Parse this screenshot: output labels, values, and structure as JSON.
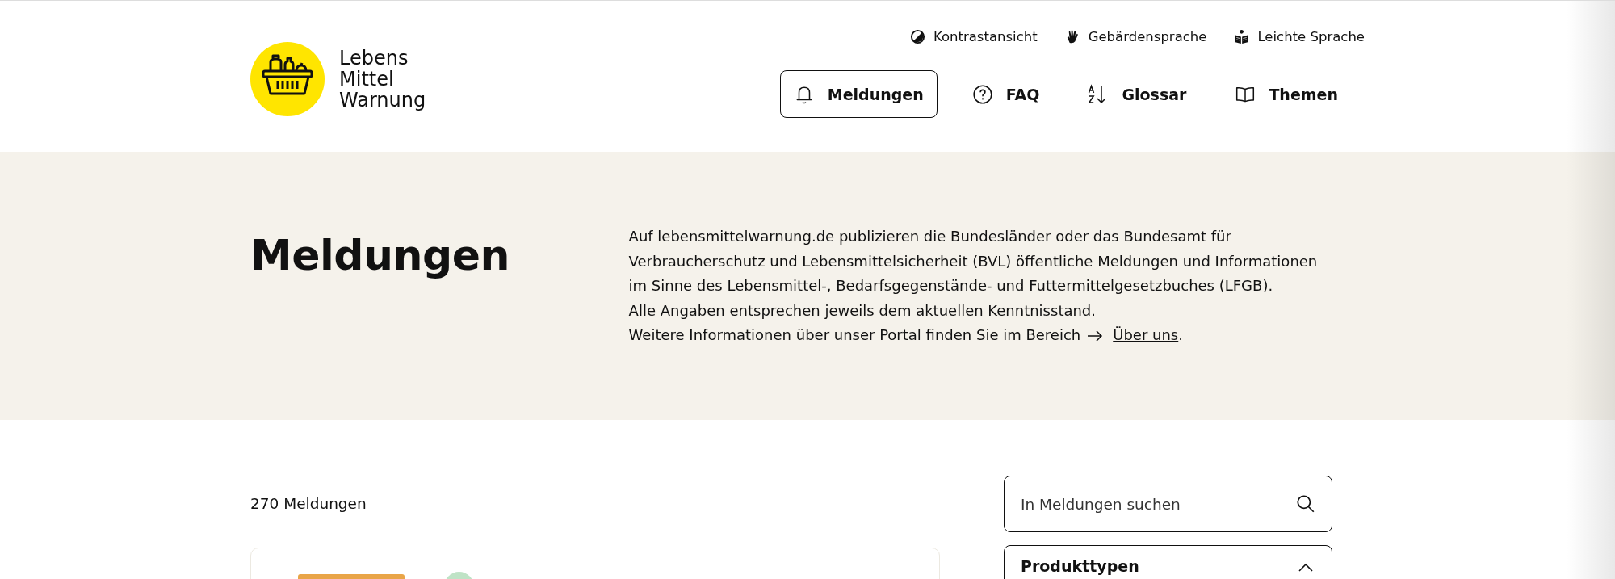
{
  "logo": {
    "lines": [
      "Lebens",
      "Mittel",
      "Warnung"
    ]
  },
  "utility_links": [
    {
      "label": "Kontrastansicht",
      "kind": "contrast"
    },
    {
      "label": "Gebärdensprache",
      "kind": "hand"
    },
    {
      "label": "Leichte Sprache",
      "kind": "reader"
    }
  ],
  "nav": [
    {
      "label": "Meldungen",
      "kind": "bell",
      "selected": true
    },
    {
      "label": "FAQ",
      "kind": "question",
      "selected": false
    },
    {
      "label": "Glossar",
      "kind": "sort",
      "selected": false
    },
    {
      "label": "Themen",
      "kind": "book",
      "selected": false
    }
  ],
  "hero": {
    "title": "Meldungen",
    "lines": [
      "Auf lebensmittelwarnung.de publizieren die Bundesländer oder das Bundesamt für",
      "Verbraucherschutz und Lebensmittelsicherheit (BVL) öffentliche Meldungen und Informationen",
      "im Sinne des Lebensmittel-, Bedarfsgegenstände- und Futtermittelgesetzbuches (LFGB).",
      "Alle Angaben entsprechen jeweils dem aktuellen Kenntnisstand.",
      "Weitere Informationen über unser Portal finden Sie im Bereich"
    ],
    "link": "Über uns",
    "link_suffix": "."
  },
  "results": {
    "count": "270 Meldungen"
  },
  "search": {
    "placeholder": "In Meldungen suchen"
  },
  "filters": [
    {
      "title": "Produkttypen",
      "expanded": true
    }
  ]
}
